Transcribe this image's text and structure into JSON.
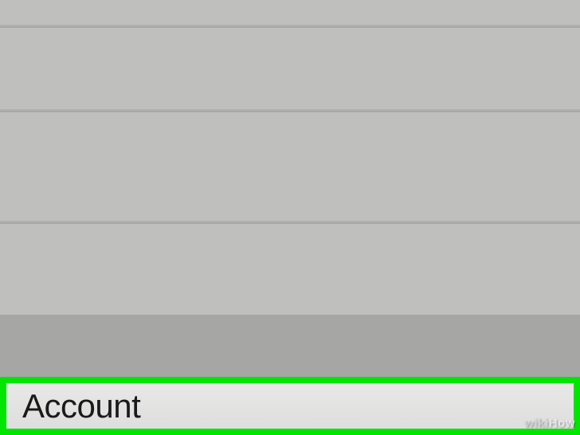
{
  "settings": {
    "highlighted_row_label": "Account"
  },
  "watermark": {
    "prefix": "wiki",
    "suffix": "How"
  }
}
